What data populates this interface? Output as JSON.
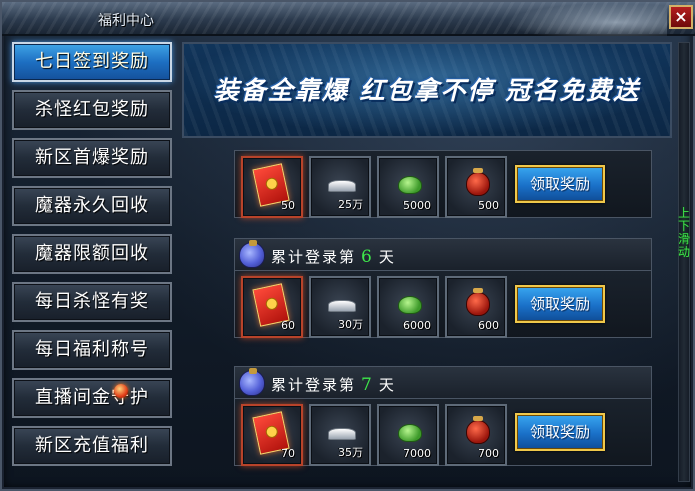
{
  "window": {
    "title": "福利中心",
    "close_label": "×"
  },
  "sidebar": {
    "items": [
      {
        "label": "七日签到奖励",
        "active": true
      },
      {
        "label": "杀怪红包奖励",
        "active": false
      },
      {
        "label": "新区首爆奖励",
        "active": false
      },
      {
        "label": "魔器永久回收",
        "active": false
      },
      {
        "label": "魔器限额回收",
        "active": false
      },
      {
        "label": "每日杀怪有奖",
        "active": false
      },
      {
        "label": "每日福利称号",
        "active": false
      },
      {
        "label": "直播间金守护",
        "active": false,
        "badge": true
      },
      {
        "label": "新区充值福利",
        "active": false
      }
    ]
  },
  "banner": {
    "text": "装备全靠爆 红包拿不停 冠名免费送"
  },
  "rewards": {
    "first": {
      "items": [
        {
          "icon": "red-envelope-icon",
          "qty": "50"
        },
        {
          "icon": "silver-ingot-icon",
          "qty": "25万"
        },
        {
          "icon": "green-gem-icon",
          "qty": "5000"
        },
        {
          "icon": "red-pot-icon",
          "qty": "500"
        }
      ],
      "claim_label": "领取奖励"
    },
    "day6": {
      "prefix": "累计登录第",
      "day": "6",
      "suffix": "天",
      "items": [
        {
          "icon": "red-envelope-icon",
          "qty": "60"
        },
        {
          "icon": "silver-ingot-icon",
          "qty": "30万"
        },
        {
          "icon": "green-gem-icon",
          "qty": "6000"
        },
        {
          "icon": "red-pot-icon",
          "qty": "600"
        }
      ],
      "claim_label": "领取奖励"
    },
    "day7": {
      "prefix": "累计登录第",
      "day": "7",
      "suffix": "天",
      "items": [
        {
          "icon": "red-envelope-icon",
          "qty": "70"
        },
        {
          "icon": "silver-ingot-icon",
          "qty": "35万"
        },
        {
          "icon": "green-gem-icon",
          "qty": "7000"
        },
        {
          "icon": "red-pot-icon",
          "qty": "700"
        }
      ],
      "claim_label": "领取奖励"
    }
  },
  "scroll_hint": "上下滑动",
  "colors": {
    "accent_blue": "#1d6fc2",
    "day_green": "#3ee84a",
    "button_gold_border": "#f0c84a"
  }
}
